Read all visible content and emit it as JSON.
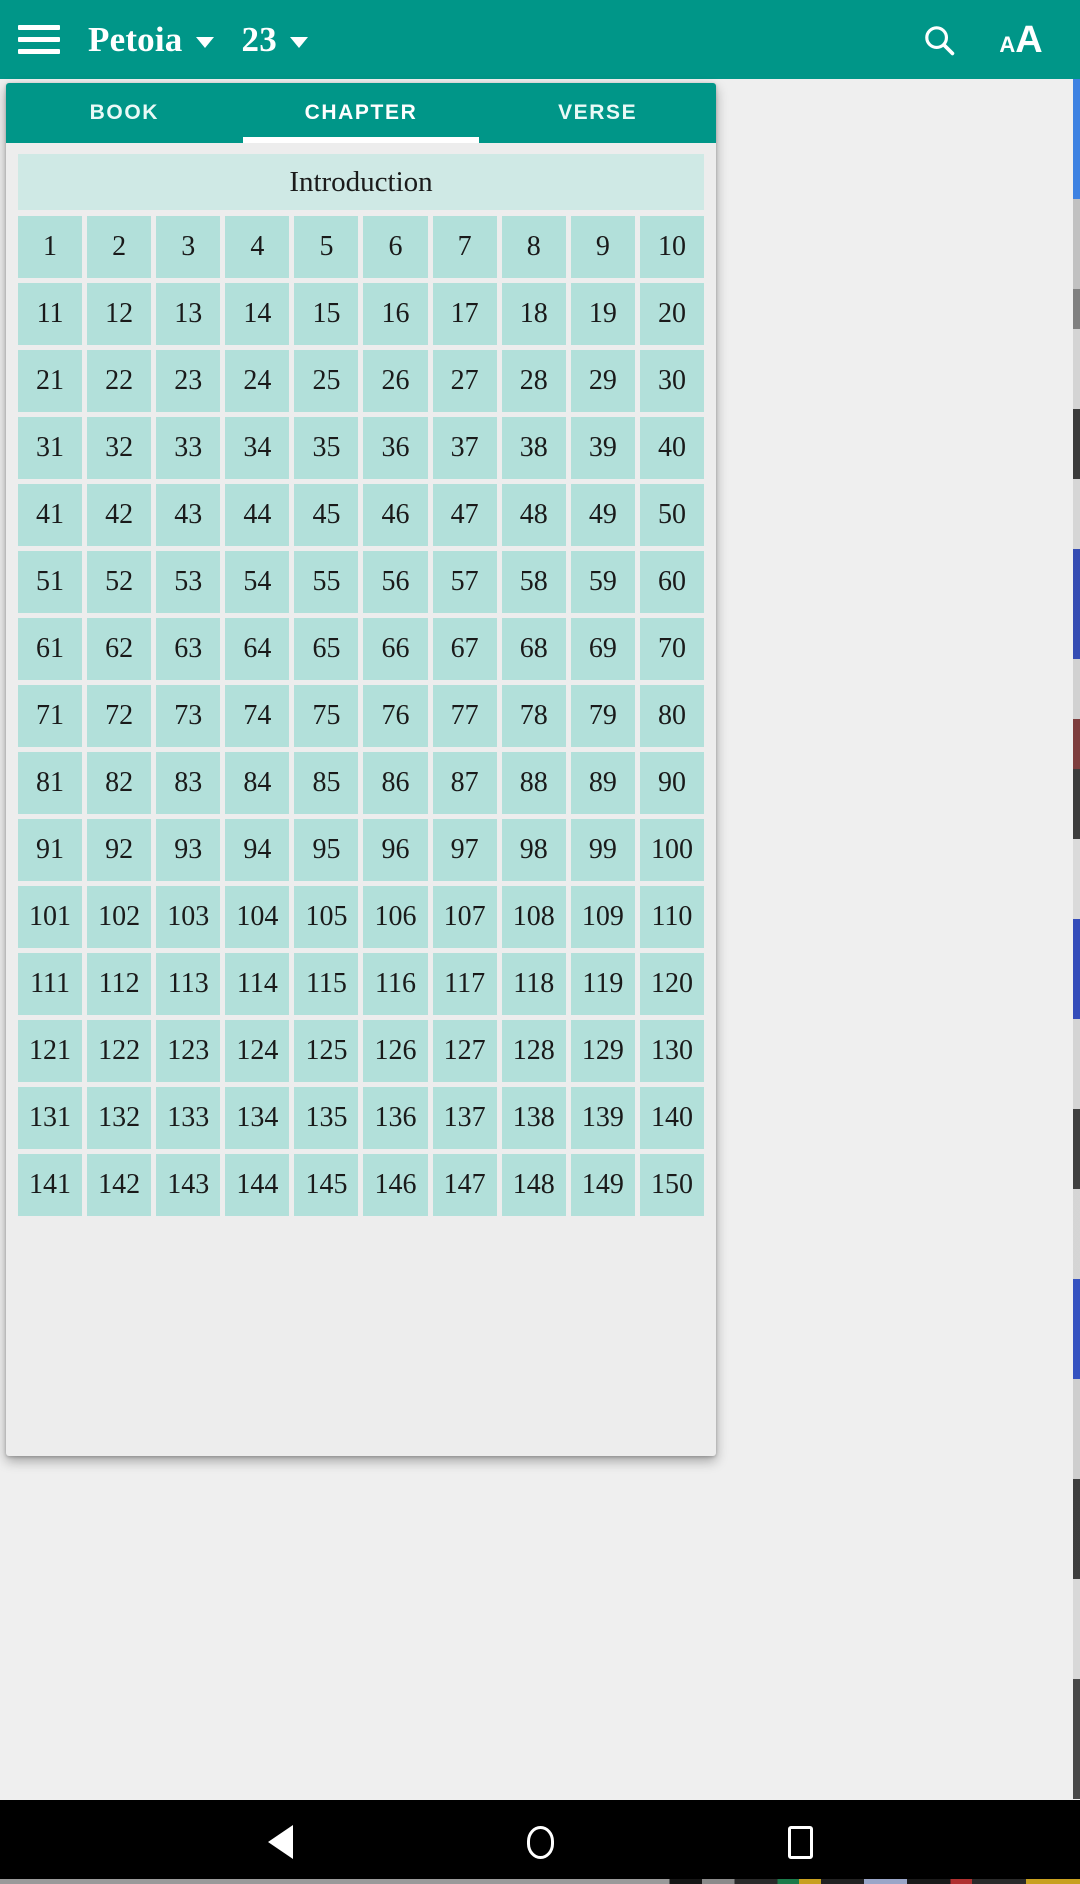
{
  "appbar": {
    "menu_icon": "hamburger-menu-icon",
    "book_title": "Petoia",
    "book_caret": "chevron-down-icon",
    "chapter_number": "23",
    "chapter_caret": "chevron-down-icon",
    "search_icon": "search-icon",
    "font_size_icon_small": "A",
    "font_size_icon_big": "A",
    "background_color": "#009688"
  },
  "picker": {
    "tabs": [
      {
        "label": "BOOK",
        "active": false
      },
      {
        "label": "CHAPTER",
        "active": true
      },
      {
        "label": "VERSE",
        "active": false
      }
    ],
    "intro_label": "Introduction",
    "intro_background": "#cfe9e5",
    "cell_background": "#b2e0da",
    "columns": 10,
    "chapters": [
      "1",
      "2",
      "3",
      "4",
      "5",
      "6",
      "7",
      "8",
      "9",
      "10",
      "11",
      "12",
      "13",
      "14",
      "15",
      "16",
      "17",
      "18",
      "19",
      "20",
      "21",
      "22",
      "23",
      "24",
      "25",
      "26",
      "27",
      "28",
      "29",
      "30",
      "31",
      "32",
      "33",
      "34",
      "35",
      "36",
      "37",
      "38",
      "39",
      "40",
      "41",
      "42",
      "43",
      "44",
      "45",
      "46",
      "47",
      "48",
      "49",
      "50",
      "51",
      "52",
      "53",
      "54",
      "55",
      "56",
      "57",
      "58",
      "59",
      "60",
      "61",
      "62",
      "63",
      "64",
      "65",
      "66",
      "67",
      "68",
      "69",
      "70",
      "71",
      "72",
      "73",
      "74",
      "75",
      "76",
      "77",
      "78",
      "79",
      "80",
      "81",
      "82",
      "83",
      "84",
      "85",
      "86",
      "87",
      "88",
      "89",
      "90",
      "91",
      "92",
      "93",
      "94",
      "95",
      "96",
      "97",
      "98",
      "99",
      "100",
      "101",
      "102",
      "103",
      "104",
      "105",
      "106",
      "107",
      "108",
      "109",
      "110",
      "111",
      "112",
      "113",
      "114",
      "115",
      "116",
      "117",
      "118",
      "119",
      "120",
      "121",
      "122",
      "123",
      "124",
      "125",
      "126",
      "127",
      "128",
      "129",
      "130",
      "131",
      "132",
      "133",
      "134",
      "135",
      "136",
      "137",
      "138",
      "139",
      "140",
      "141",
      "142",
      "143",
      "144",
      "145",
      "146",
      "147",
      "148",
      "149",
      "150"
    ]
  },
  "navbar": {
    "back_icon": "back-triangle-icon",
    "home_icon": "home-circle-icon",
    "recents_icon": "recents-square-icon"
  }
}
